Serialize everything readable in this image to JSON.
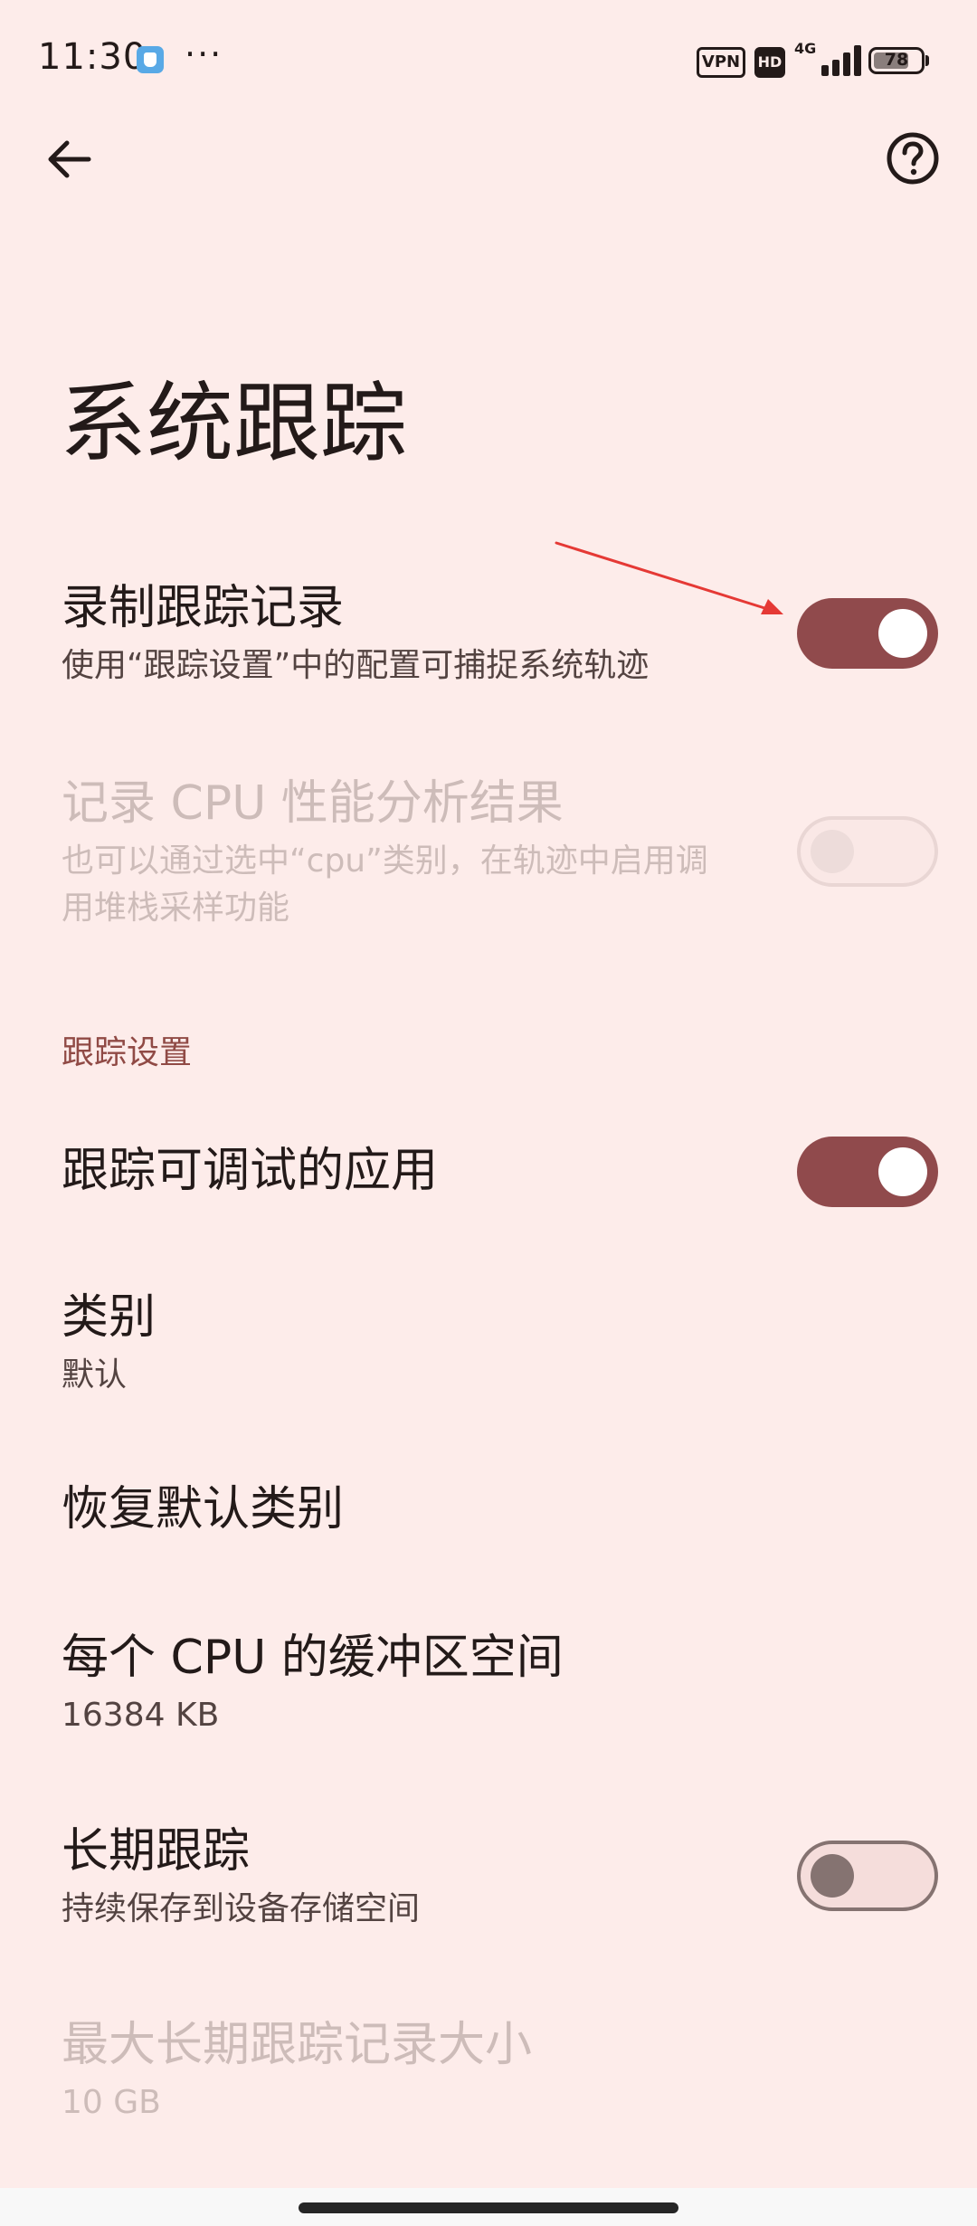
{
  "status_bar": {
    "time": "11:30",
    "more": "···",
    "vpn": "VPN",
    "hd": "HD",
    "network": "4G",
    "battery_percent": "78",
    "battery_level": 0.78
  },
  "toolbar": {
    "back_icon": "arrow-back-icon",
    "help_icon": "help-circle-icon"
  },
  "page": {
    "title": "系统跟踪"
  },
  "preferences": [
    {
      "title": "录制跟踪记录",
      "summary": "使用“跟踪设置”中的配置可捕捉系统轨迹",
      "switch": "on",
      "enabled": true
    },
    {
      "title": "记录 CPU 性能分析结果",
      "summary_line1": "也可以通过选中“cpu”类别，在轨迹中启用调",
      "summary_line2": "用堆栈采样功能",
      "switch": "off",
      "enabled": false
    }
  ],
  "section": {
    "header": "跟踪设置",
    "items": [
      {
        "title": "跟踪可调试的应用",
        "switch": "on"
      },
      {
        "title": "类别",
        "summary": "默认"
      },
      {
        "title": "恢复默认类别"
      },
      {
        "title": "每个 CPU 的缓冲区空间",
        "summary": "16384 KB"
      },
      {
        "title": "长期跟踪",
        "summary": "持续保存到设备存储空间",
        "switch": "off"
      },
      {
        "title": "最大长期跟踪记录大小",
        "summary": "10 GB",
        "enabled": false
      }
    ]
  },
  "colors": {
    "background": "#fdecea",
    "accent": "#904a4c",
    "section_header": "#904a45",
    "annotation_arrow": "#e53935"
  }
}
